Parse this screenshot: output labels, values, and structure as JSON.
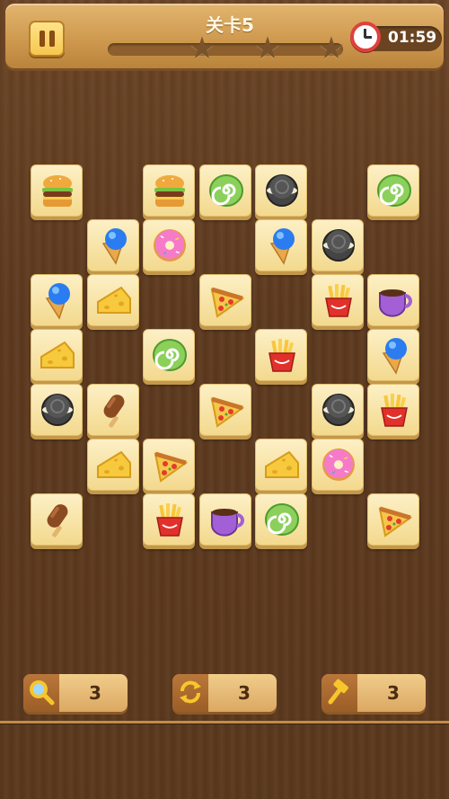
{
  "header": {
    "level_label": "关卡5",
    "timer": "01:59",
    "stars_total": 3,
    "stars_earned": 0
  },
  "icons": {
    "pause": "pause-icon",
    "clock": "alarm-clock-icon",
    "star": "star-icon"
  },
  "board": {
    "tiles": [
      {
        "kind": "burger"
      },
      {
        "kind": "burger"
      },
      {
        "kind": "swiss-roll"
      },
      {
        "kind": "cookie"
      },
      {
        "kind": "swiss-roll"
      },
      {
        "kind": "ice-cream"
      },
      {
        "kind": "donut"
      },
      {
        "kind": "ice-cream"
      },
      {
        "kind": "cookie"
      },
      {
        "kind": "ice-cream"
      },
      {
        "kind": "cheese"
      },
      {
        "kind": "pizza"
      },
      {
        "kind": "fries"
      },
      {
        "kind": "coffee"
      },
      {
        "kind": "cheese"
      },
      {
        "kind": "swiss-roll"
      },
      {
        "kind": "fries"
      },
      {
        "kind": "ice-cream"
      },
      {
        "kind": "cookie"
      },
      {
        "kind": "popsicle"
      },
      {
        "kind": "pizza"
      },
      {
        "kind": "cookie"
      },
      {
        "kind": "fries"
      },
      {
        "kind": "cheese"
      },
      {
        "kind": "pizza"
      },
      {
        "kind": "cheese"
      },
      {
        "kind": "donut"
      },
      {
        "kind": "popsicle"
      },
      {
        "kind": "fries"
      },
      {
        "kind": "coffee"
      },
      {
        "kind": "swiss-roll"
      },
      {
        "kind": "pizza"
      }
    ]
  },
  "tools": [
    {
      "name": "magnifier",
      "icon": "magnifier-icon",
      "count": "3"
    },
    {
      "name": "shuffle",
      "icon": "shuffle-icon",
      "count": "3"
    },
    {
      "name": "hammer",
      "icon": "hammer-icon",
      "count": "3"
    }
  ]
}
